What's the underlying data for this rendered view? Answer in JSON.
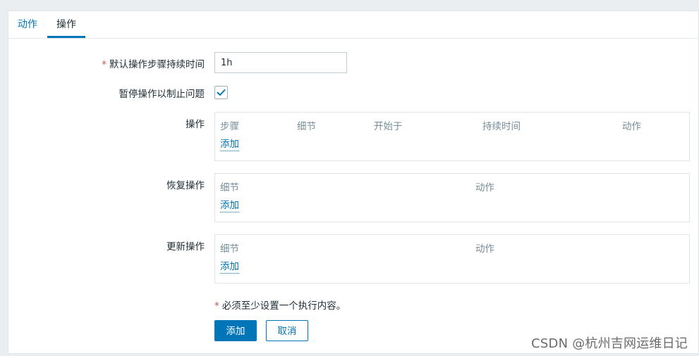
{
  "tabs": [
    {
      "label": "动作",
      "active": false
    },
    {
      "label": "操作",
      "active": true
    }
  ],
  "form": {
    "default_step_duration": {
      "required_mark": "*",
      "label": "默认操作步骤持续时间",
      "value": "1h"
    },
    "pause_operations": {
      "label": "暂停操作以制止问题",
      "checked": true
    },
    "operations": {
      "label": "操作",
      "columns": [
        "步骤",
        "细节",
        "开始于",
        "持续时间",
        "动作"
      ],
      "add_link": "添加"
    },
    "recovery_operations": {
      "label": "恢复操作",
      "columns": [
        "细节",
        "动作"
      ],
      "add_link": "添加"
    },
    "update_operations": {
      "label": "更新操作",
      "columns": [
        "细节",
        "动作"
      ],
      "add_link": "添加"
    },
    "note": {
      "required_mark": "*",
      "text": "必须至少设置一个执行内容。"
    }
  },
  "buttons": {
    "add": "添加",
    "cancel": "取消"
  },
  "watermark": "CSDN @杭州吉网运维日记",
  "colors": {
    "accent": "#0275b8",
    "required": "#d64e4e",
    "muted": "#768d99"
  },
  "icons": {
    "checkbox": "check-icon"
  }
}
